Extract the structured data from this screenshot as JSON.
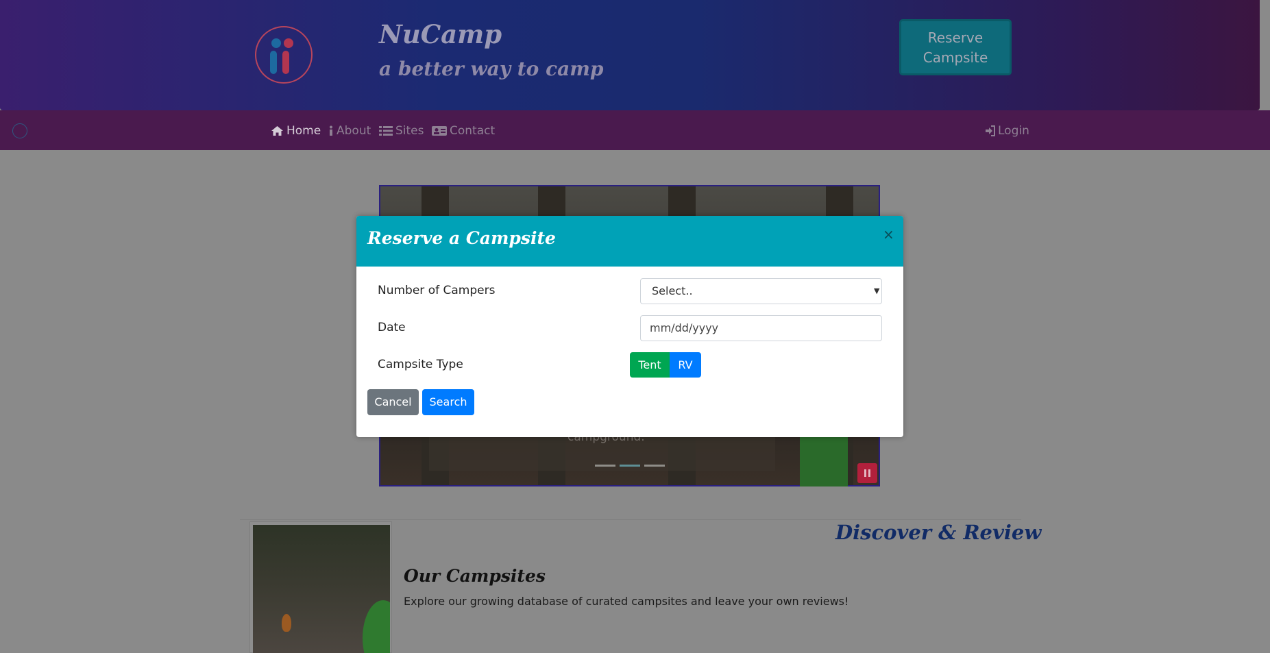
{
  "header": {
    "title": "NuCamp",
    "tagline": "a better way to camp",
    "reserve_button": "Reserve Campsite"
  },
  "nav": {
    "items": [
      {
        "label": "Home",
        "icon": "home-icon",
        "active": true
      },
      {
        "label": "About",
        "icon": "info-icon",
        "active": false
      },
      {
        "label": "Sites",
        "icon": "list-icon",
        "active": false
      },
      {
        "label": "Contact",
        "icon": "address-card-icon",
        "active": false
      }
    ],
    "login": {
      "label": "Login",
      "icon": "sign-in-icon"
    }
  },
  "carousel": {
    "caption_fragment": "campground.",
    "indicators": 3,
    "active_indicator": 1
  },
  "content": {
    "discover_heading": "Discover & Review",
    "card_title": "Our Campsites",
    "card_text": "Explore our growing database of curated campsites and leave your own reviews!"
  },
  "modal": {
    "title": "Reserve a Campsite",
    "close_symbol": "×",
    "fields": {
      "campers_label": "Number of Campers",
      "campers_value": "Select..",
      "date_label": "Date",
      "date_placeholder": "mm/dd/yyyy",
      "type_label": "Campsite Type",
      "type_options": [
        "Tent",
        "RV"
      ]
    },
    "cancel_label": "Cancel",
    "search_label": "Search"
  },
  "colors": {
    "modal_header": "#00a2b7",
    "tent_button": "#00a652",
    "primary": "#007bff",
    "secondary": "#6c757d",
    "navbar": "#4a1a4e"
  }
}
